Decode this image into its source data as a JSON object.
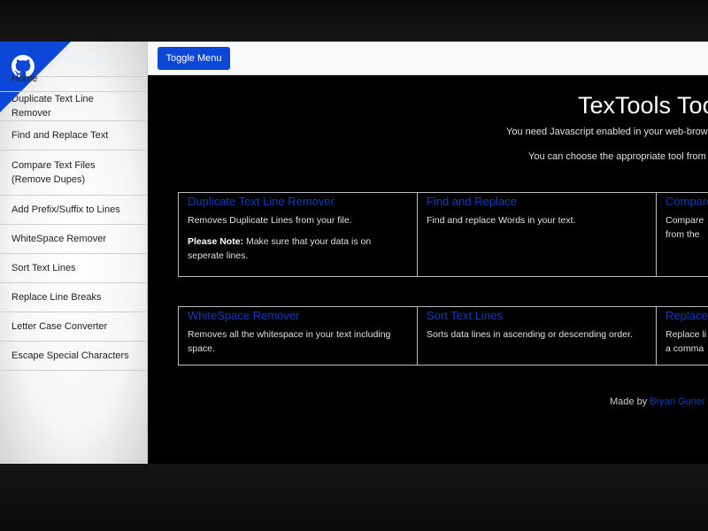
{
  "sidebar": {
    "brand": "TexTools",
    "items": [
      {
        "label": "Home"
      },
      {
        "label": "Duplicate Text Line Remover"
      },
      {
        "label": "Find and Replace Text"
      },
      {
        "label": "Compare Text Files (Remove Dupes)"
      },
      {
        "label": "Add Prefix/Suffix to Lines"
      },
      {
        "label": "WhiteSpace Remover"
      },
      {
        "label": "Sort Text Lines"
      },
      {
        "label": "Replace Line Breaks"
      },
      {
        "label": "Letter Case Converter"
      },
      {
        "label": "Escape Special Characters"
      }
    ],
    "corner_color": "#0d47d7",
    "corner_icon": "github-icon"
  },
  "navbar": {
    "toggle_label": "Toggle Menu",
    "button_color": "#0d47d7"
  },
  "main": {
    "title": "TexTools Tools",
    "subtitle1": "You need Javascript enabled in your web-browser",
    "subtitle2": "You can choose the appropriate tool from",
    "row1": [
      {
        "title": "Duplicate Text Line Remover",
        "text": "Removes Duplicate Lines from your file.",
        "note_label": "Please Note:",
        "note_text": " Make sure that your data is on seperate lines."
      },
      {
        "title": "Find and Replace",
        "text": "Find and replace Words in your text."
      },
      {
        "title": "Compare",
        "text": "Compare",
        "text2": "from the"
      }
    ],
    "row2": [
      {
        "title": "WhiteSpace Remover",
        "text": "Removes all the whitespace in your text including space."
      },
      {
        "title": "Sort Text Lines",
        "text": "Sorts data lines in ascending or descending order."
      },
      {
        "title": "Replace",
        "text": "Replace li",
        "text2": "a comma"
      }
    ],
    "footer_prefix": "Made by ",
    "footer_author": "Bryan Guner",
    "link_color": "#0d3dbb"
  }
}
